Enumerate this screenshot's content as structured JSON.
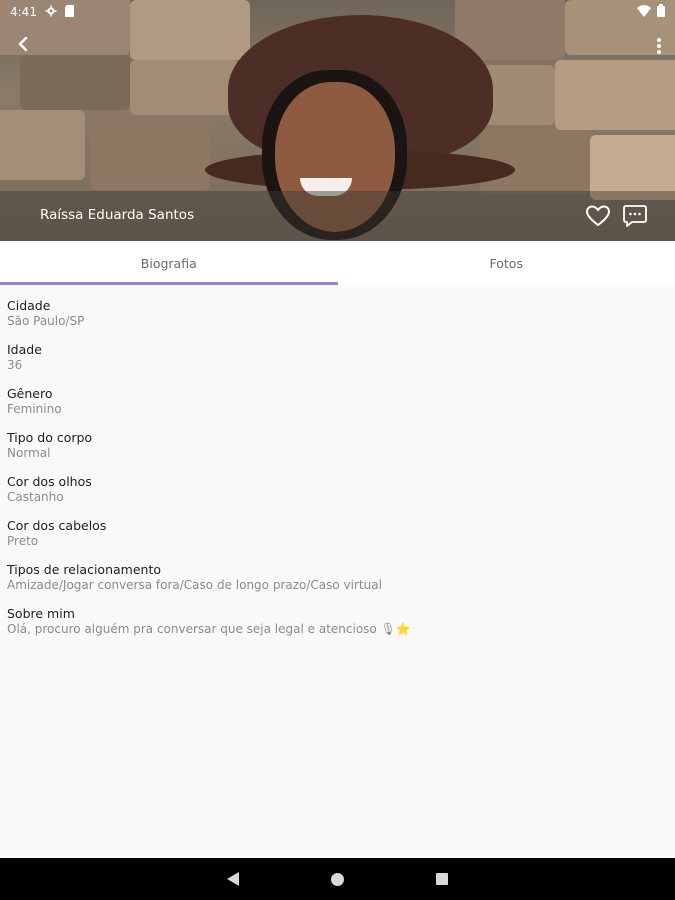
{
  "status_bar": {
    "time": "4:41"
  },
  "profile": {
    "name": "Raíssa Eduarda Santos"
  },
  "tabs": [
    {
      "label": "Biografia",
      "active": true
    },
    {
      "label": "Fotos",
      "active": false
    }
  ],
  "bio": [
    {
      "label": "Cidade",
      "value": "São Paulo/SP"
    },
    {
      "label": "Idade",
      "value": "36"
    },
    {
      "label": "Gênero",
      "value": "Feminino"
    },
    {
      "label": "Tipo do corpo",
      "value": "Normal"
    },
    {
      "label": "Cor dos olhos",
      "value": "Castanho"
    },
    {
      "label": "Cor dos cabelos",
      "value": "Preto"
    },
    {
      "label": "Tipos de relacionamento",
      "value": "Amizade/Jogar conversa fora/Caso de longo prazo/Caso virtual"
    },
    {
      "label": "Sobre mim",
      "value": "Olá, procuro alguém pra conversar que seja legal e atencioso 🎙⭐"
    }
  ],
  "colors": {
    "accent": "#8a86e6",
    "label": "#1f1f1f",
    "value": "#8b8b8b",
    "background": "#f9f9fa"
  },
  "icons": [
    "back-arrow-icon",
    "more-vert-icon",
    "heart-outline-icon",
    "chat-bubble-icon",
    "settings-icon",
    "sim-icon",
    "wifi-icon",
    "battery-icon"
  ]
}
